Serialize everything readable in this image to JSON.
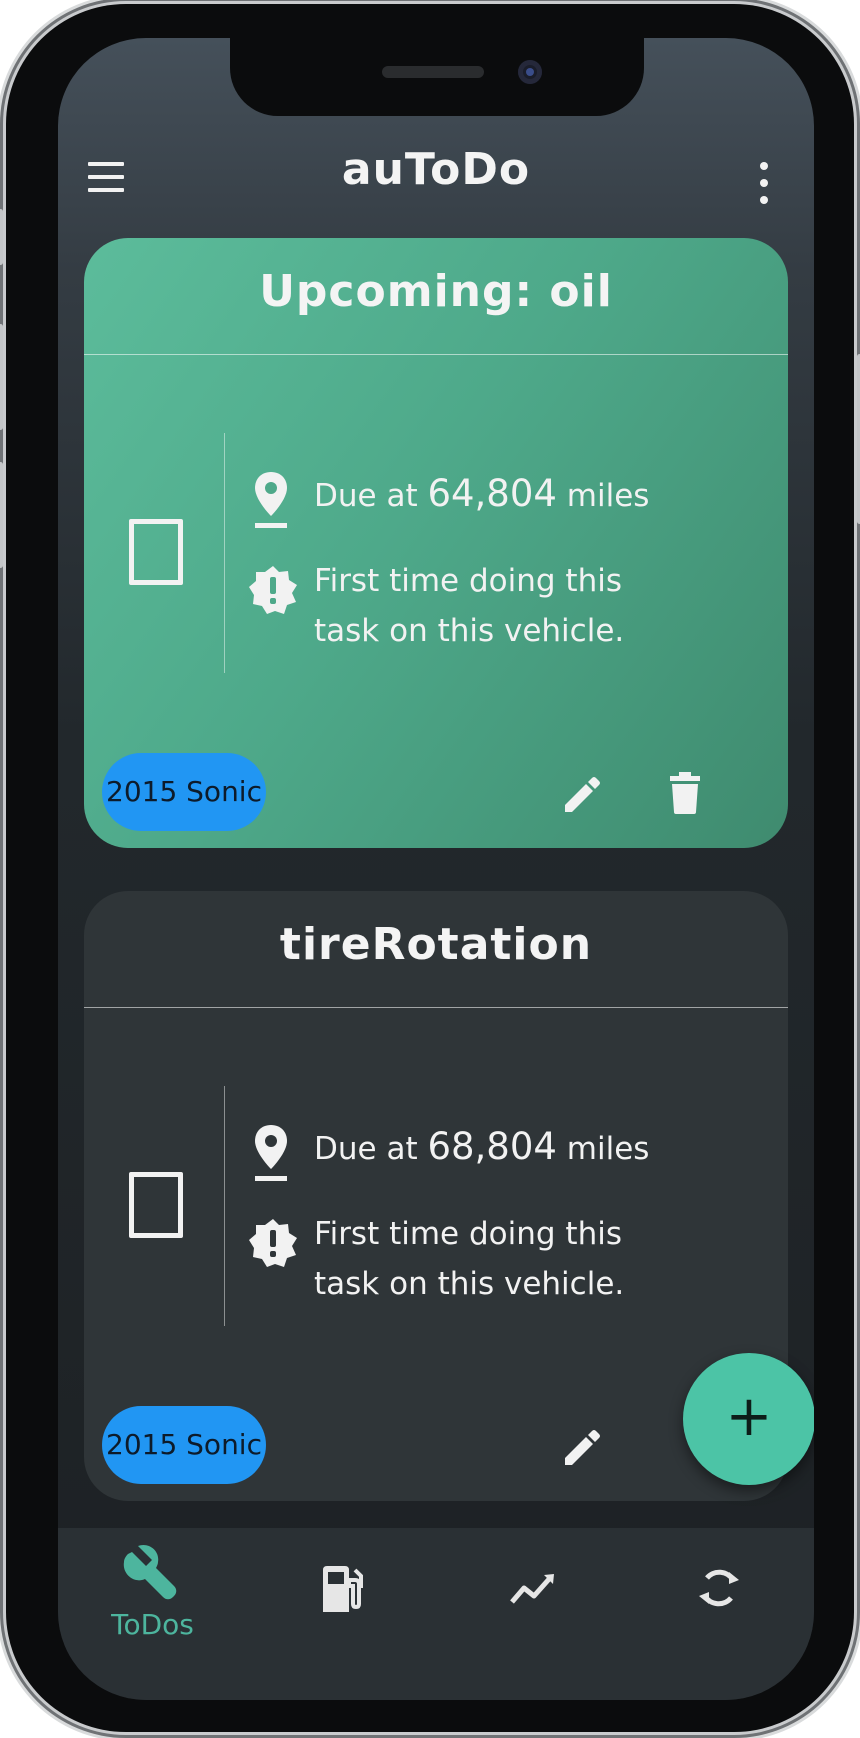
{
  "app": {
    "title": "auToDo"
  },
  "cards": [
    {
      "title": "Upcoming: oil",
      "due_prefix": "Due at",
      "due_value": "64,804",
      "due_suffix": "miles",
      "note": "First time doing this task on this vehicle.",
      "car": "2015 Sonic",
      "accent": "#4ea98a"
    },
    {
      "title": "tireRotation",
      "due_prefix": "Due at",
      "due_value": "68,804",
      "due_suffix": "miles",
      "note": "First time doing this task on this vehicle.",
      "car": "2015 Sonic",
      "accent": "#2f3538"
    }
  ],
  "fab": {
    "label": "+",
    "color": "#4cc4a6"
  },
  "bottom_nav": {
    "items": [
      {
        "icon": "wrench-icon",
        "label": "ToDos",
        "active": true
      },
      {
        "icon": "gas-pump-icon",
        "label": "",
        "active": false
      },
      {
        "icon": "trending-up-icon",
        "label": "",
        "active": false
      },
      {
        "icon": "refresh-icon",
        "label": "",
        "active": false
      }
    ],
    "active_color": "#4db59e",
    "inactive_color": "#e6e6e6"
  },
  "colors": {
    "chip": "#2196f3",
    "card_active": "#4ea98a",
    "card_default": "#2f3538"
  }
}
